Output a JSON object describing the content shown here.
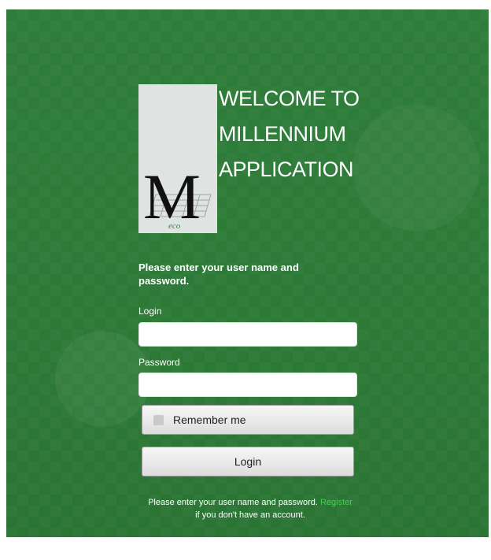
{
  "welcome": {
    "line1": "WELCOME TO",
    "line2": "MILLENNIUM",
    "line3": "APPLICATION"
  },
  "logo": {
    "letter": "M",
    "subtext": "eco"
  },
  "form": {
    "instructions": "Please enter your user name and password.",
    "login_label": "Login",
    "login_value": "",
    "password_label": "Password",
    "password_value": "",
    "remember_label": "Remember me",
    "remember_checked": false,
    "submit_label": "Login"
  },
  "footer": {
    "text": "Please enter your user name and password.",
    "register_link": "Register",
    "text_after": "if you don't have an account."
  },
  "colors": {
    "background": "#2f7d3a",
    "link": "#3ed34f"
  }
}
